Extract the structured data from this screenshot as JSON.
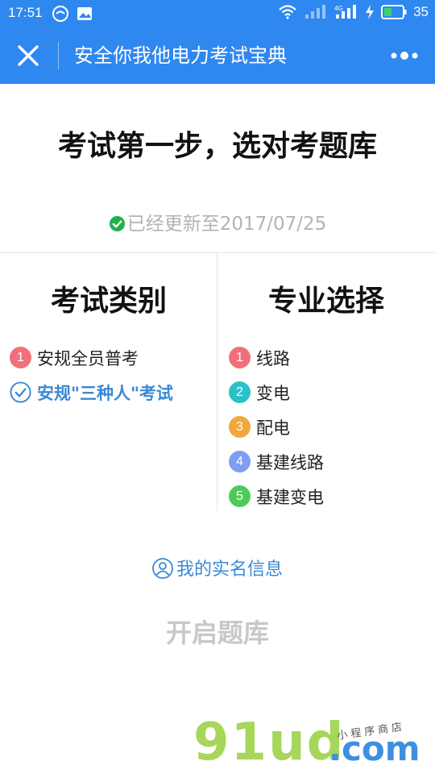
{
  "status_bar": {
    "time": "17:51",
    "battery": "35",
    "icons": [
      "wechat-moment-icon",
      "image-icon",
      "wifi-icon",
      "signal-icon",
      "signal-4g-icon",
      "charging-icon",
      "battery-icon"
    ]
  },
  "nav": {
    "title": "安全你我他电力考试宝典",
    "close_icon": "close-icon",
    "more_icon": "more-icon"
  },
  "headline": "考试第一步，选对考题库",
  "update_text": "已经更新至2017/07/25",
  "categories": {
    "title": "考试类别",
    "items": [
      {
        "num": "1",
        "label": "安规全员普考",
        "selected": false
      },
      {
        "num": "",
        "label": "安规\"三种人\"考试",
        "selected": true
      }
    ]
  },
  "majors": {
    "title": "专业选择",
    "items": [
      {
        "num": "1",
        "label": "线路"
      },
      {
        "num": "2",
        "label": "变电"
      },
      {
        "num": "3",
        "label": "配电"
      },
      {
        "num": "4",
        "label": "基建线路"
      },
      {
        "num": "5",
        "label": "基建变电"
      }
    ]
  },
  "realname_link": "我的实名信息",
  "start_button": "开启题库",
  "watermark": {
    "main": "91ud",
    "com": ".com",
    "tag": "小程序商店"
  },
  "colors": {
    "primary": "#2f87f0",
    "link": "#3a88d6",
    "badge_1": "#f0707a",
    "badge_2": "#2bc1c9",
    "badge_3": "#f0a838",
    "badge_4": "#7f9df2",
    "badge_5": "#4fca5a",
    "update_check": "#21b14b"
  }
}
